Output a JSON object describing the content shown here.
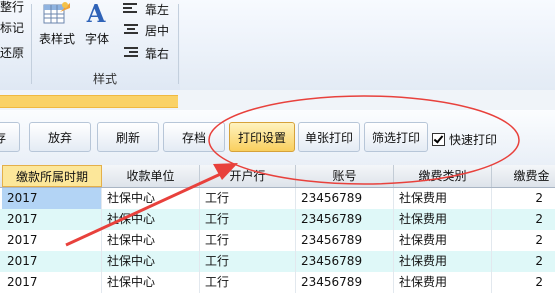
{
  "ribbon": {
    "left_items": [
      "整行",
      "标记",
      "还原"
    ],
    "table_style_label": "表样式",
    "font_label": "字体",
    "font_glyph": "A",
    "align_items": [
      "靠左",
      "居中",
      "靠右"
    ],
    "group_label": "样式"
  },
  "progress": {
    "value_percent": 32,
    "color": "#fad267"
  },
  "toolbar": {
    "buttons": [
      "存",
      "放弃",
      "刷新",
      "存档",
      "打印设置",
      "单张打印",
      "筛选打印"
    ],
    "active_button": "打印设置",
    "quick_print_label": "快速打印",
    "quick_print_checked": true
  },
  "table": {
    "headers": [
      "缴款所属时期",
      "收款单位",
      "开户行",
      "账号",
      "缴费类别",
      "缴费金"
    ],
    "selected_header": "缴款所属时期",
    "rows": [
      [
        "2017",
        "社保中心",
        "工行",
        "23456789",
        "社保费用",
        "2"
      ],
      [
        "2017",
        "社保中心",
        "工行",
        "23456789",
        "社保费用",
        "2"
      ],
      [
        "2017",
        "社保中心",
        "工行",
        "23456789",
        "社保费用",
        "2"
      ],
      [
        "2017",
        "社保中心",
        "工行",
        "23456789",
        "社保费用",
        "2"
      ],
      [
        "2017",
        "社保中心",
        "工行",
        "23456789",
        "社保费用",
        "2"
      ]
    ],
    "row_colors": [
      "#ffffff",
      "#dff8f8"
    ]
  },
  "annotation": {
    "color": "#e8413c"
  }
}
